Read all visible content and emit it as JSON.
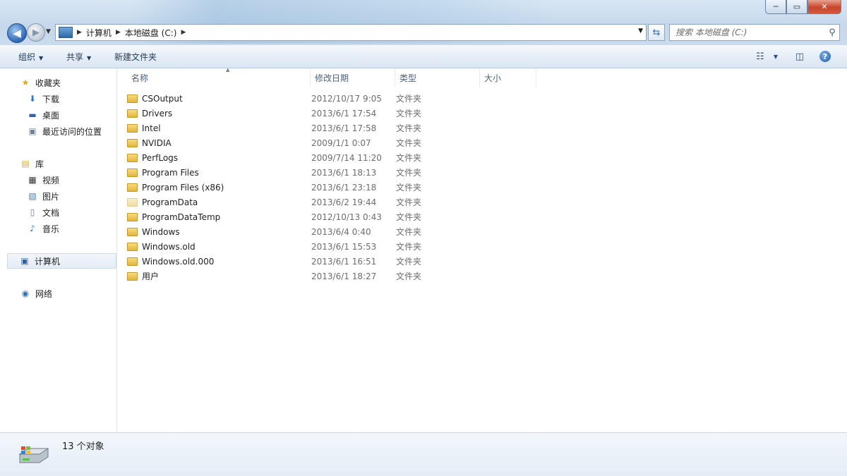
{
  "window": {
    "caption": {
      "min": "─",
      "max": "▭",
      "close": "✕"
    }
  },
  "navbar": {
    "breadcrumb": [
      "计算机",
      "本地磁盘 (C:)"
    ],
    "search_placeholder": "搜索 本地磁盘 (C:)"
  },
  "toolbar": {
    "organize": "组织",
    "share": "共享",
    "new_folder": "新建文件夹"
  },
  "sidebar": {
    "favorites": {
      "label": "收藏夹",
      "items": [
        "下载",
        "桌面",
        "最近访问的位置"
      ]
    },
    "libraries": {
      "label": "库",
      "items": [
        "视频",
        "图片",
        "文档",
        "音乐"
      ]
    },
    "computer": "计算机",
    "network": "网络"
  },
  "columns": {
    "name": "名称",
    "date": "修改日期",
    "type": "类型",
    "size": "大小"
  },
  "files": [
    {
      "name": "CSOutput",
      "date": "2012/10/17 9:05",
      "type": "文件夹"
    },
    {
      "name": "Drivers",
      "date": "2013/6/1 17:54",
      "type": "文件夹"
    },
    {
      "name": "Intel",
      "date": "2013/6/1 17:58",
      "type": "文件夹"
    },
    {
      "name": "NVIDIA",
      "date": "2009/1/1 0:07",
      "type": "文件夹"
    },
    {
      "name": "PerfLogs",
      "date": "2009/7/14 11:20",
      "type": "文件夹"
    },
    {
      "name": "Program Files",
      "date": "2013/6/1 18:13",
      "type": "文件夹"
    },
    {
      "name": "Program Files (x86)",
      "date": "2013/6/1 23:18",
      "type": "文件夹"
    },
    {
      "name": "ProgramData",
      "date": "2013/6/2 19:44",
      "type": "文件夹"
    },
    {
      "name": "ProgramDataTemp",
      "date": "2012/10/13 0:43",
      "type": "文件夹"
    },
    {
      "name": "Windows",
      "date": "2013/6/4 0:40",
      "type": "文件夹"
    },
    {
      "name": "Windows.old",
      "date": "2013/6/1 15:53",
      "type": "文件夹"
    },
    {
      "name": "Windows.old.000",
      "date": "2013/6/1 16:51",
      "type": "文件夹"
    },
    {
      "name": "用户",
      "date": "2013/6/1 18:27",
      "type": "文件夹"
    }
  ],
  "status": {
    "count_text": "13 个对象"
  }
}
